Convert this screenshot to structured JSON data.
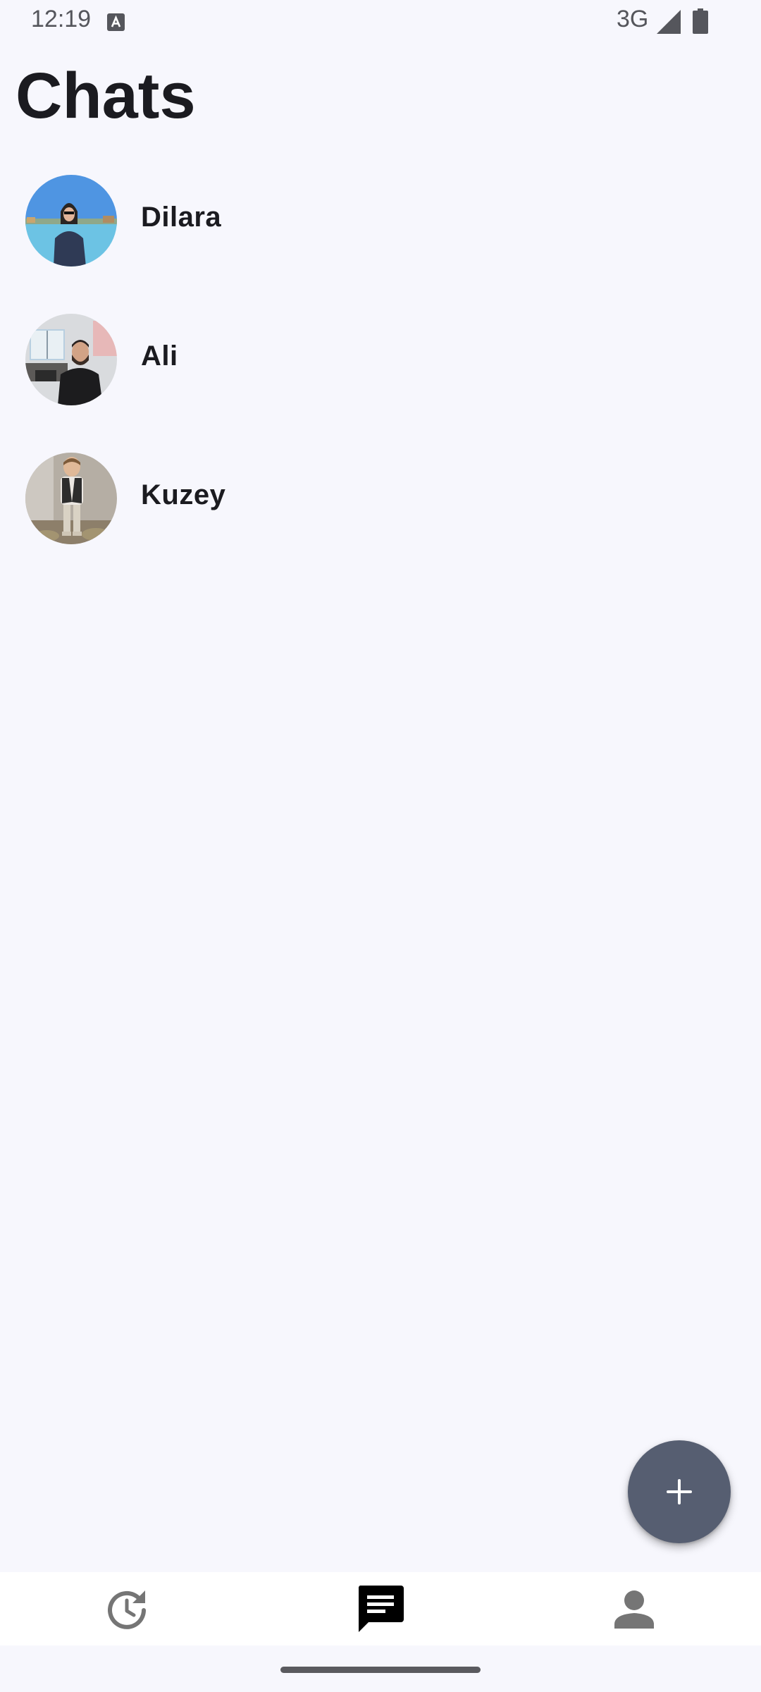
{
  "status_bar": {
    "time": "12:19",
    "network": "3G",
    "icons": [
      "keyboard-a-icon",
      "signal-icon",
      "battery-icon"
    ]
  },
  "header": {
    "title": "Chats"
  },
  "chats": [
    {
      "name": "Dilara",
      "avatar": "photo-avatar"
    },
    {
      "name": "Ali",
      "avatar": "photo-avatar"
    },
    {
      "name": "Kuzey",
      "avatar": "photo-avatar"
    }
  ],
  "fab": {
    "icon": "plus-icon",
    "color": "#565e71"
  },
  "bottom_nav": {
    "items": [
      {
        "icon": "history-icon",
        "selected": false
      },
      {
        "icon": "chat-icon",
        "selected": true
      },
      {
        "icon": "person-icon",
        "selected": false
      }
    ]
  },
  "colors": {
    "background": "#f7f7fd",
    "text": "#1b1b20",
    "nav_background": "#ffffff",
    "icon_inactive": "#757575"
  }
}
